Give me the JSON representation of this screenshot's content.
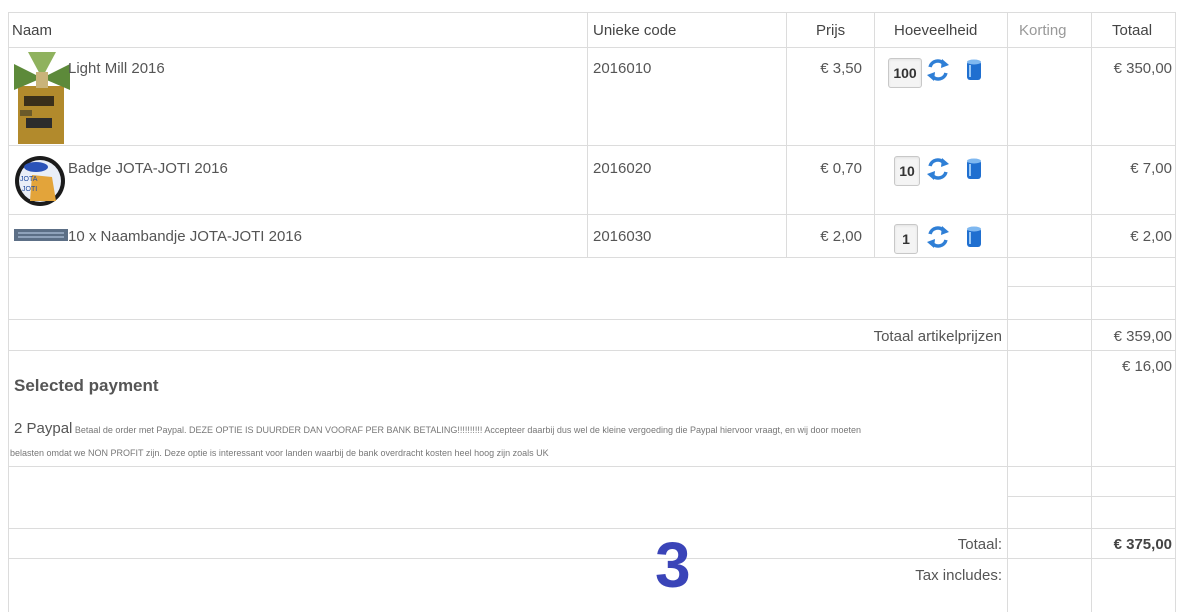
{
  "columns": {
    "name": "Naam",
    "code": "Unieke code",
    "price": "Prijs",
    "qty": "Hoeveelheid",
    "discount": "Korting",
    "total": "Totaal"
  },
  "items": [
    {
      "name": "Light Mill 2016",
      "code": "2016010",
      "price": "€ 3,50",
      "qty": "100",
      "total": "€ 350,00"
    },
    {
      "name": "Badge JOTA-JOTI 2016",
      "code": "2016020",
      "price": "€ 0,70",
      "qty": "10",
      "total": "€ 7,00"
    },
    {
      "name": "10 x Naambandje JOTA-JOTI 2016",
      "code": "2016030",
      "price": "€ 2,00",
      "qty": "1",
      "total": "€ 2,00"
    }
  ],
  "subtotal": {
    "label": "Totaal artikelprijzen",
    "value": "€ 359,00"
  },
  "payment": {
    "title": "Selected payment",
    "name": "2 Paypal",
    "description_line1": "Betaal de order met Paypal. DEZE OPTIE IS DUURDER DAN VOORAF PER BANK BETALING!!!!!!!!!! Accepteer daarbij dus wel de kleine vergoeding die Paypal hiervoor vraagt, en wij door moeten",
    "description_line2": "belasten omdat we NON PROFIT zijn. Deze optie is interessant voor landen waarbij de bank overdracht kosten heel hoog zijn zoals UK",
    "fee": "€ 16,00"
  },
  "grand_total": {
    "label": "Totaal:",
    "value": "€ 375,00"
  },
  "tax": {
    "label": "Tax includes:"
  },
  "step_number": "3",
  "icons": {
    "update": "refresh-arrows-icon",
    "delete": "trash-can-icon"
  },
  "colors": {
    "icon_blue": "#2f7fd6",
    "step_blue": "#3a44b8",
    "border": "#dcdcdc"
  }
}
